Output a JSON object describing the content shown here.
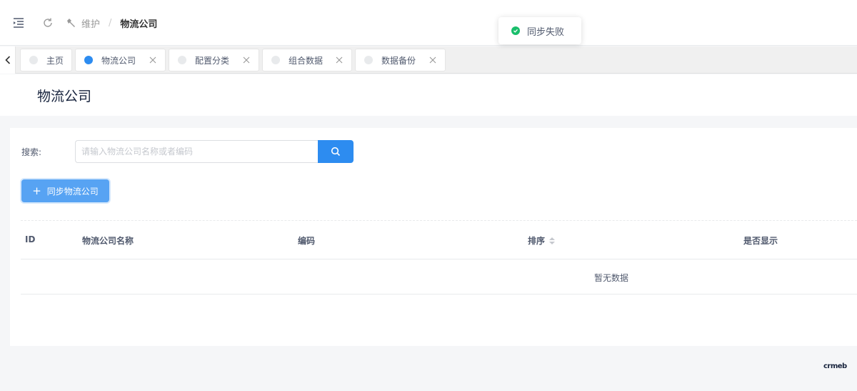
{
  "header": {
    "breadcrumb_parent": "维护",
    "breadcrumb_separator": "/",
    "breadcrumb_current": "物流公司"
  },
  "toast": {
    "message": "同步失败",
    "status_color": "#19be6b"
  },
  "tabs": [
    {
      "label": "主页",
      "active": false,
      "closable": false
    },
    {
      "label": "物流公司",
      "active": true,
      "closable": true
    },
    {
      "label": "配置分类",
      "active": false,
      "closable": true
    },
    {
      "label": "组合数据",
      "active": false,
      "closable": true
    },
    {
      "label": "数据备份",
      "active": false,
      "closable": true
    }
  ],
  "page": {
    "title": "物流公司"
  },
  "search": {
    "label": "搜索:",
    "placeholder": "请输入物流公司名称或者编码",
    "value": ""
  },
  "actions": {
    "sync_label": "同步物流公司"
  },
  "table": {
    "columns": [
      "ID",
      "物流公司名称",
      "编码",
      "排序",
      "是否显示"
    ],
    "empty_text": "暂无数据"
  },
  "footer": {
    "brand": "crmeb"
  },
  "colors": {
    "primary": "#2d8cf0",
    "primary_light": "#57a3f3",
    "success": "#19be6b"
  }
}
